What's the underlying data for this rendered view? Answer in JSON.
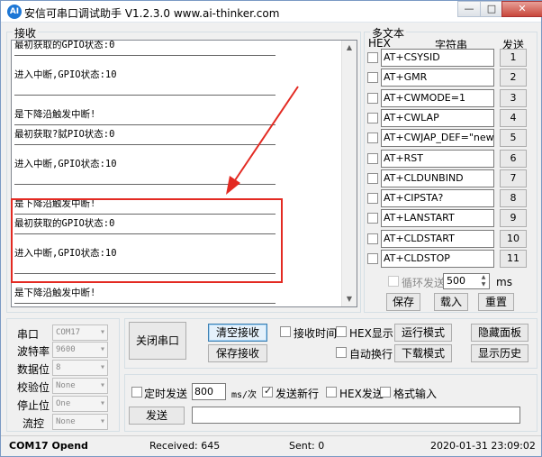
{
  "title": "安信可串口调试助手 V1.2.3.0    www.ai-thinker.com",
  "app_icon_text": "AI",
  "window_controls": {
    "minimize": "—",
    "maximize": "□",
    "close": "✕"
  },
  "receive": {
    "label": "接收",
    "lines": [
      {
        "type": "text",
        "text": "最初获取的GPIO状态:0"
      },
      {
        "type": "sep"
      },
      {
        "type": "blank"
      },
      {
        "type": "text",
        "text": "进入中断,GPIO状态:10"
      },
      {
        "type": "blank"
      },
      {
        "type": "sep"
      },
      {
        "type": "blank"
      },
      {
        "type": "text",
        "text": "是下降沿触发中断!"
      },
      {
        "type": "sep"
      },
      {
        "type": "text",
        "text": "最初获取?脦PIO状态:0"
      },
      {
        "type": "sep"
      },
      {
        "type": "blank"
      },
      {
        "type": "text",
        "text": "进入中断,GPIO状态:10"
      },
      {
        "type": "blank"
      },
      {
        "type": "sep"
      },
      {
        "type": "blank"
      },
      {
        "type": "text",
        "text": "是下降沿触发中断!"
      },
      {
        "type": "sep"
      },
      {
        "type": "text",
        "text": "最初获取的GPIO状态:0"
      },
      {
        "type": "sep"
      },
      {
        "type": "blank"
      },
      {
        "type": "text",
        "text": "进入中断,GPIO状态:10"
      },
      {
        "type": "blank"
      },
      {
        "type": "sep"
      },
      {
        "type": "blank"
      },
      {
        "type": "text",
        "text": "是下降沿触发中断!"
      },
      {
        "type": "sep"
      }
    ],
    "scroll_up": "▲",
    "scroll_down": "▼"
  },
  "multi_text": {
    "label": "多文本",
    "col_hex": "HEX",
    "col_string": "字符串",
    "col_send": "发送",
    "rows": [
      {
        "value": "AT+CSYSID",
        "num": "1"
      },
      {
        "value": "AT+GMR",
        "num": "2"
      },
      {
        "value": "AT+CWMODE=1",
        "num": "3"
      },
      {
        "value": "AT+CWLAP",
        "num": "4"
      },
      {
        "value": "AT+CWJAP_DEF=\"newifi_",
        "num": "5"
      },
      {
        "value": "AT+RST",
        "num": "6"
      },
      {
        "value": "AT+CLDUNBIND",
        "num": "7"
      },
      {
        "value": "AT+CIPSTA?",
        "num": "8"
      },
      {
        "value": "AT+LANSTART",
        "num": "9"
      },
      {
        "value": "AT+CLDSTART",
        "num": "10"
      },
      {
        "value": "AT+CLDSTOP",
        "num": "11"
      }
    ],
    "loop_send_label": "循环发送",
    "loop_interval": "500",
    "loop_unit": "ms",
    "save_label": "保存",
    "load_label": "载入",
    "reset_label": "重置"
  },
  "port_settings": {
    "port_label": "串口",
    "port_value": "COM17",
    "baud_label": "波特率",
    "baud_value": "9600",
    "data_label": "数据位",
    "data_value": "8",
    "parity_label": "校验位",
    "parity_value": "None",
    "stop_label": "停止位",
    "stop_value": "One",
    "flow_label": "流控",
    "flow_value": "None"
  },
  "controls": {
    "close_port": "关闭串口",
    "clear_recv": "清空接收",
    "save_recv": "保存接收",
    "recv_time": "接收时间",
    "hex_display": "HEX显示",
    "run_mode": "运行模式",
    "hide_panel": "隐藏面板",
    "auto_newline": "自动换行",
    "download_mode": "下载模式",
    "show_history": "显示历史"
  },
  "send": {
    "timed_send": "定时发送",
    "interval": "800",
    "interval_unit": "ms/次",
    "send_newline": "发送新行",
    "hex_send": "HEX发送",
    "format_input": "格式输入",
    "send_button": "发送",
    "send_text": ""
  },
  "status": {
    "port": "COM17 Opend",
    "received": "Received: 645",
    "sent": "Sent: 0",
    "datetime": "2020-01-31 23:09:02"
  },
  "colors": {
    "highlight": "#e32a22",
    "accent": "#1d77d6"
  }
}
